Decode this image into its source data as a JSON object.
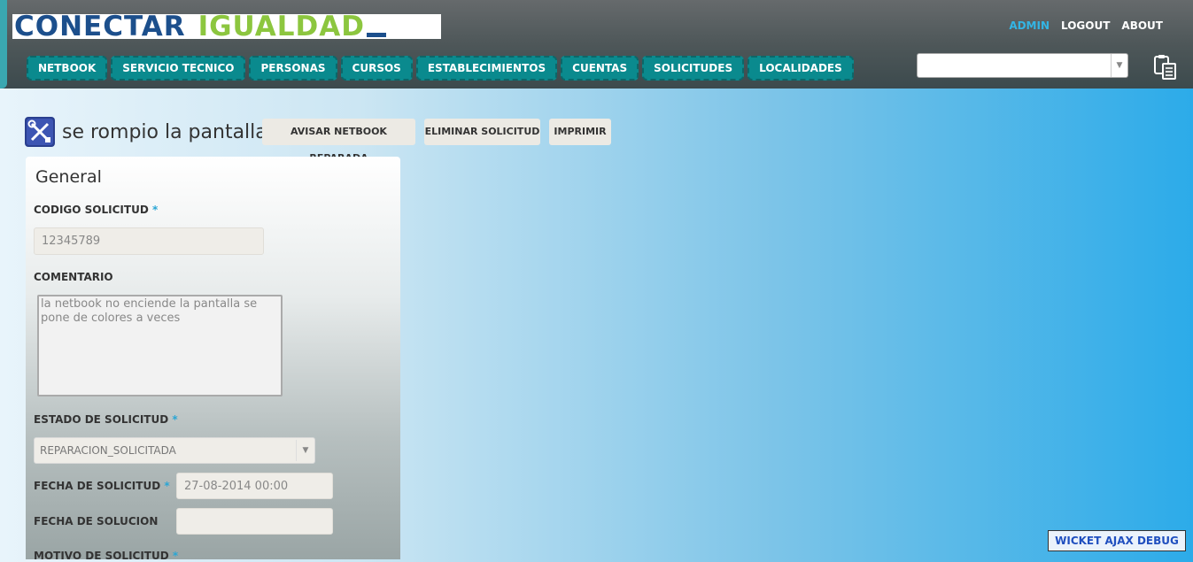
{
  "header": {
    "logo": {
      "part1": "CONECTAR",
      "part2": "IGUALDAD"
    },
    "links": [
      {
        "label": "ADMIN",
        "active": true
      },
      {
        "label": "LOGOUT",
        "active": false
      },
      {
        "label": "ABOUT",
        "active": false
      }
    ],
    "nav": [
      {
        "label": "NETBOOK"
      },
      {
        "label": "SERVICIO TECNICO"
      },
      {
        "label": "PERSONAS"
      },
      {
        "label": "CURSOS"
      },
      {
        "label": "ESTABLECIMIENTOS"
      },
      {
        "label": "CUENTAS"
      },
      {
        "label": "SOLICITUDES"
      },
      {
        "label": "LOCALIDADES"
      }
    ],
    "select_value": "",
    "clipboard_icon": "clipboard-icon"
  },
  "page": {
    "icon": "tools-icon",
    "title": "se rompio la pantalla",
    "actions": {
      "notify": "AVISAR NETBOOK REPARADA",
      "delete": "ELIMINAR SOLICITUD",
      "print": "IMPRIMIR"
    }
  },
  "form": {
    "section_title": "General",
    "required_mark": "*",
    "codigo": {
      "label": "CODIGO SOLICITUD",
      "value": "12345789"
    },
    "comentario": {
      "label": "COMENTARIO",
      "value": "la netbook no enciende la pantalla se pone de colores a veces"
    },
    "estado": {
      "label": "ESTADO DE SOLICITUD",
      "value": "REPARACION_SOLICITADA"
    },
    "fecha_solicitud": {
      "label": "FECHA DE SOLICITUD",
      "value": "27-08-2014 00:00"
    },
    "fecha_solucion": {
      "label": "FECHA DE SOLUCION",
      "value": ""
    },
    "motivo": {
      "label": "MOTIVO DE SOLICITUD"
    }
  },
  "debug": {
    "label": "WICKET AJAX DEBUG"
  },
  "colors": {
    "accent": "#33b5e5",
    "nav": "#0a8a8e",
    "header": "#4e5759"
  }
}
